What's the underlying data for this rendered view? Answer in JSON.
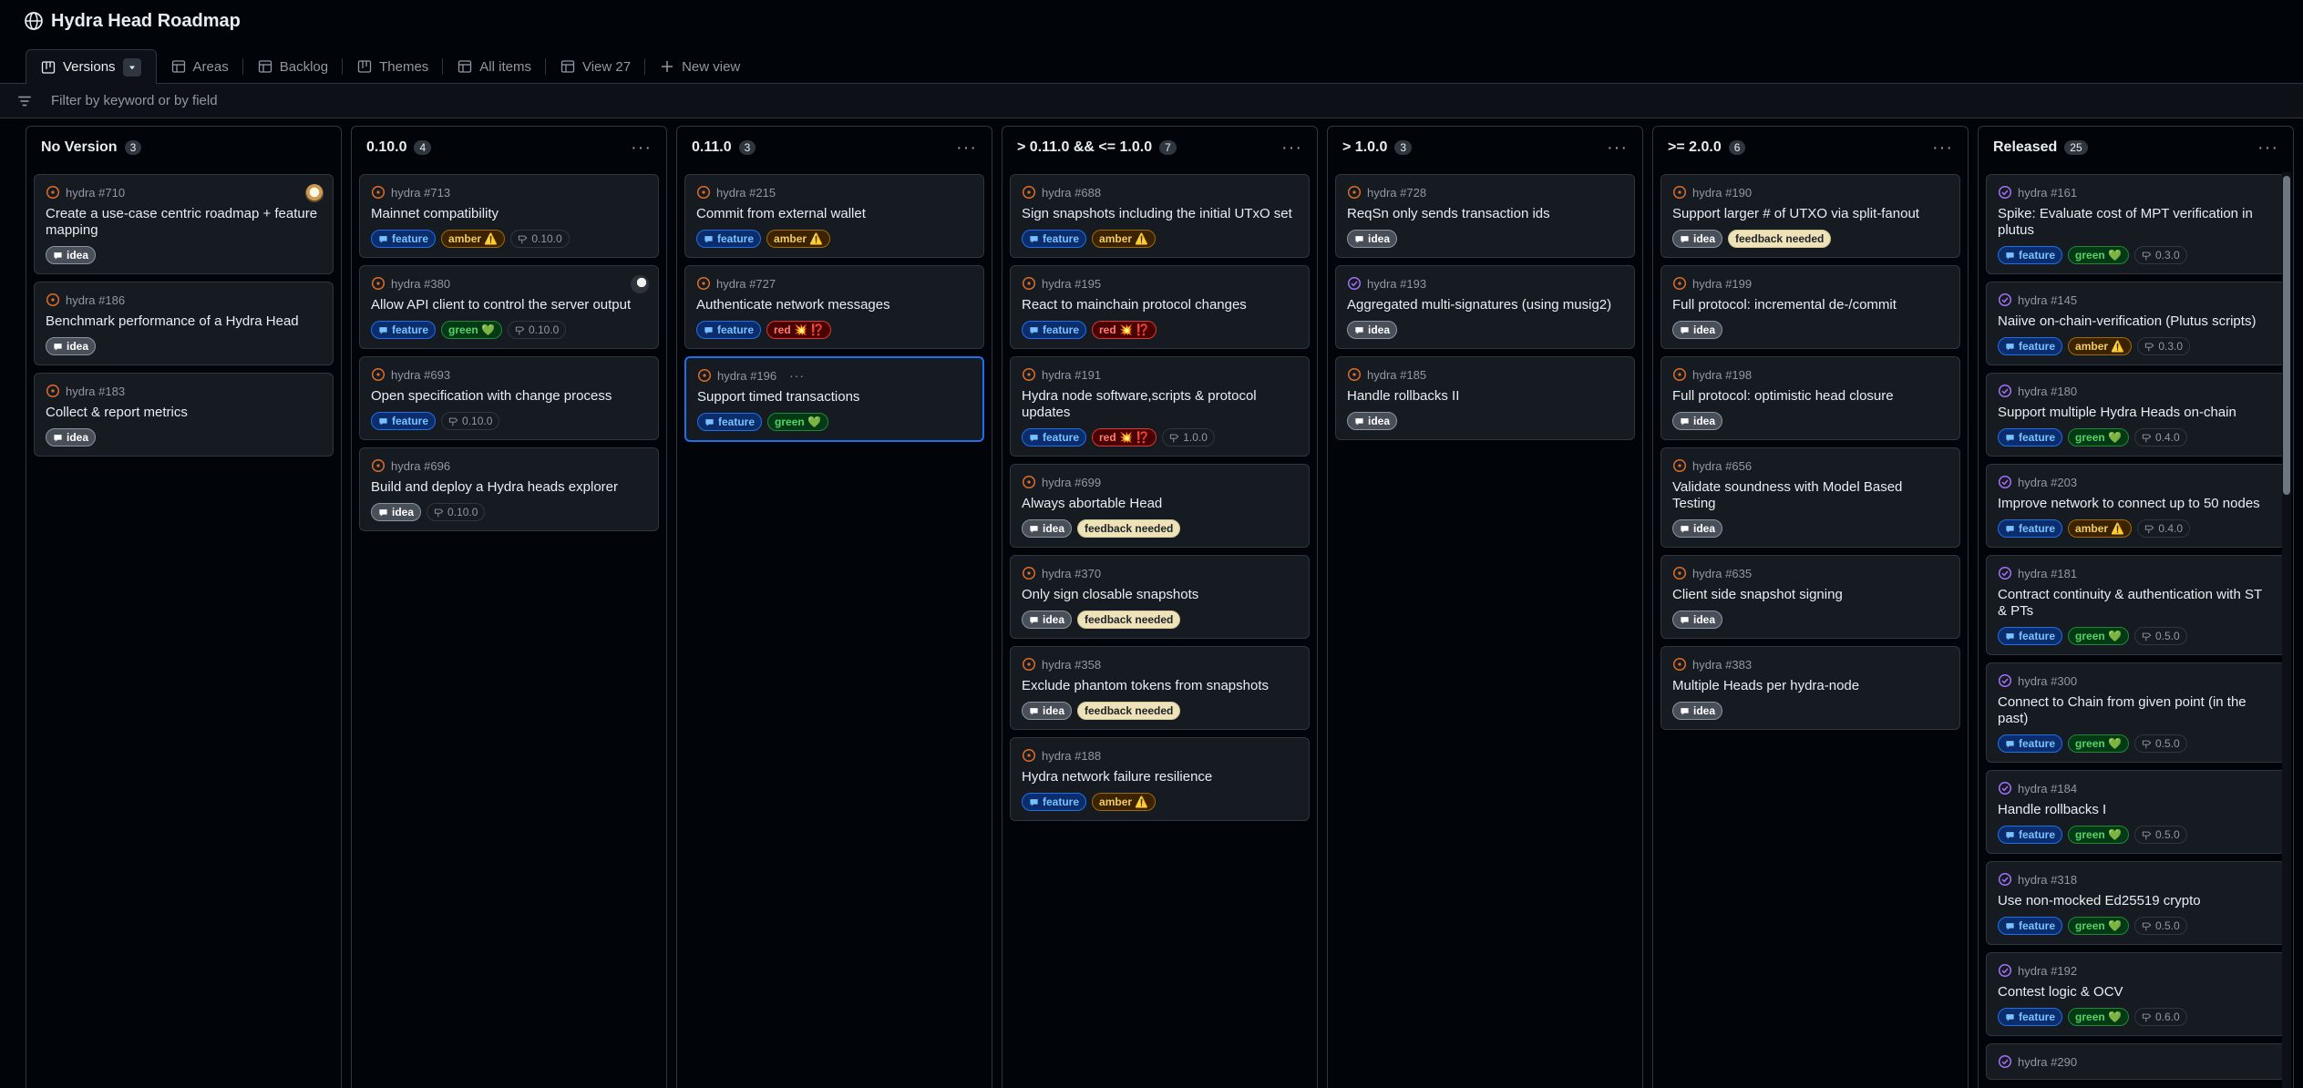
{
  "project": {
    "title": "Hydra Head Roadmap"
  },
  "tabs": [
    {
      "label": "Versions",
      "active": true,
      "icon": "board-icon"
    },
    {
      "label": "Areas",
      "icon": "table-icon"
    },
    {
      "label": "Backlog",
      "icon": "table-icon"
    },
    {
      "label": "Themes",
      "icon": "board-icon"
    },
    {
      "label": "All items",
      "icon": "table-icon"
    },
    {
      "label": "View 27",
      "icon": "table-icon"
    },
    {
      "label": "New view",
      "icon": "plus-icon"
    }
  ],
  "filter": {
    "placeholder": "Filter by keyword or by field"
  },
  "colors": {
    "open_issue": "#db6d28",
    "closed_issue": "#a371f7",
    "selected_border": "#1f6feb"
  },
  "columns": [
    {
      "title": "No Version",
      "count": "3",
      "show_menu": false,
      "cards": [
        {
          "ref": "hydra #710",
          "title": "Create a use-case centric roadmap + feature mapping",
          "status": "open",
          "avatar": "cat",
          "labels": [
            [
              "idea",
              "idea"
            ]
          ]
        },
        {
          "ref": "hydra #186",
          "title": "Benchmark performance of a Hydra Head",
          "status": "open",
          "labels": [
            [
              "idea",
              "idea"
            ]
          ]
        },
        {
          "ref": "hydra #183",
          "title": "Collect & report metrics",
          "status": "open",
          "labels": [
            [
              "idea",
              "idea"
            ]
          ]
        }
      ]
    },
    {
      "title": "0.10.0",
      "count": "4",
      "show_menu": true,
      "cards": [
        {
          "ref": "hydra #713",
          "title": "Mainnet compatibility",
          "status": "open",
          "labels": [
            [
              "feature",
              "feature"
            ],
            [
              "amber",
              "amber ⚠️"
            ]
          ],
          "milestone": "0.10.0"
        },
        {
          "ref": "hydra #380",
          "title": "Allow API client to control the server output",
          "status": "open",
          "avatar": "dark",
          "labels": [
            [
              "feature",
              "feature"
            ],
            [
              "green",
              "green 💚"
            ]
          ],
          "milestone": "0.10.0"
        },
        {
          "ref": "hydra #693",
          "title": "Open specification with change process",
          "status": "open",
          "labels": [
            [
              "feature",
              "feature"
            ]
          ],
          "milestone": "0.10.0"
        },
        {
          "ref": "hydra #696",
          "title": "Build and deploy a Hydra heads explorer",
          "status": "open",
          "labels": [
            [
              "idea",
              "idea"
            ]
          ],
          "milestone": "0.10.0"
        }
      ]
    },
    {
      "title": "0.11.0",
      "count": "3",
      "show_menu": true,
      "cards": [
        {
          "ref": "hydra #215",
          "title": "Commit from external wallet",
          "status": "open",
          "labels": [
            [
              "feature",
              "feature"
            ],
            [
              "amber",
              "amber ⚠️"
            ]
          ]
        },
        {
          "ref": "hydra #727",
          "title": "Authenticate network messages",
          "status": "open",
          "labels": [
            [
              "feature",
              "feature"
            ],
            [
              "red",
              "red 💥 ⁉️"
            ]
          ]
        },
        {
          "ref": "hydra #196",
          "title": "Support timed transactions",
          "status": "open",
          "selected": true,
          "more": "···",
          "labels": [
            [
              "feature",
              "feature"
            ],
            [
              "green",
              "green 💚"
            ]
          ]
        }
      ]
    },
    {
      "title": "> 0.11.0 && <= 1.0.0",
      "count": "7",
      "show_menu": true,
      "cards": [
        {
          "ref": "hydra #688",
          "title": "Sign snapshots including the initial UTxO set",
          "status": "open",
          "labels": [
            [
              "feature",
              "feature"
            ],
            [
              "amber",
              "amber ⚠️"
            ]
          ]
        },
        {
          "ref": "hydra #195",
          "title": "React to mainchain protocol changes",
          "status": "open",
          "labels": [
            [
              "feature",
              "feature"
            ],
            [
              "red",
              "red 💥 ⁉️"
            ]
          ]
        },
        {
          "ref": "hydra #191",
          "title": "Hydra node software,scripts & protocol updates",
          "status": "open",
          "labels": [
            [
              "feature",
              "feature"
            ],
            [
              "red",
              "red 💥 ⁉️"
            ]
          ],
          "milestone": "1.0.0"
        },
        {
          "ref": "hydra #699",
          "title": "Always abortable Head",
          "status": "open",
          "labels": [
            [
              "idea",
              "idea"
            ],
            [
              "feedback",
              "feedback needed"
            ]
          ]
        },
        {
          "ref": "hydra #370",
          "title": "Only sign closable snapshots",
          "status": "open",
          "labels": [
            [
              "idea",
              "idea"
            ],
            [
              "feedback",
              "feedback needed"
            ]
          ]
        },
        {
          "ref": "hydra #358",
          "title": "Exclude phantom tokens from snapshots",
          "status": "open",
          "labels": [
            [
              "idea",
              "idea"
            ],
            [
              "feedback",
              "feedback needed"
            ]
          ]
        },
        {
          "ref": "hydra #188",
          "title": "Hydra network failure resilience",
          "status": "open",
          "labels": [
            [
              "feature",
              "feature"
            ],
            [
              "amber",
              "amber ⚠️"
            ]
          ]
        }
      ]
    },
    {
      "title": "> 1.0.0",
      "count": "3",
      "show_menu": true,
      "cards": [
        {
          "ref": "hydra #728",
          "title": "ReqSn only sends transaction ids",
          "status": "open",
          "labels": [
            [
              "idea",
              "idea"
            ]
          ]
        },
        {
          "ref": "hydra #193",
          "title": "Aggregated multi-signatures (using musig2)",
          "status": "closed",
          "labels": [
            [
              "idea",
              "idea"
            ]
          ]
        },
        {
          "ref": "hydra #185",
          "title": "Handle rollbacks II",
          "status": "open",
          "labels": [
            [
              "idea",
              "idea"
            ]
          ]
        }
      ]
    },
    {
      "title": ">= 2.0.0",
      "count": "6",
      "show_menu": true,
      "cards": [
        {
          "ref": "hydra #190",
          "title": "Support larger # of UTXO via split-fanout",
          "status": "open",
          "labels": [
            [
              "idea",
              "idea"
            ],
            [
              "feedback",
              "feedback needed"
            ]
          ]
        },
        {
          "ref": "hydra #199",
          "title": "Full protocol: incremental de-/commit",
          "status": "open",
          "labels": [
            [
              "idea",
              "idea"
            ]
          ]
        },
        {
          "ref": "hydra #198",
          "title": "Full protocol: optimistic head closure",
          "status": "open",
          "labels": [
            [
              "idea",
              "idea"
            ]
          ]
        },
        {
          "ref": "hydra #656",
          "title": "Validate soundness with Model Based Testing",
          "status": "open",
          "labels": [
            [
              "idea",
              "idea"
            ]
          ]
        },
        {
          "ref": "hydra #635",
          "title": "Client side snapshot signing",
          "status": "open",
          "labels": [
            [
              "idea",
              "idea"
            ]
          ]
        },
        {
          "ref": "hydra #383",
          "title": "Multiple Heads per hydra-node",
          "status": "open",
          "labels": [
            [
              "idea",
              "idea"
            ]
          ]
        }
      ]
    },
    {
      "title": "Released",
      "count": "25",
      "show_menu": true,
      "scroll": true,
      "cards": [
        {
          "ref": "hydra #161",
          "title": "Spike: Evaluate cost of MPT verification in plutus",
          "status": "closed",
          "labels": [
            [
              "feature",
              "feature"
            ],
            [
              "green",
              "green 💚"
            ]
          ],
          "milestone": "0.3.0"
        },
        {
          "ref": "hydra #145",
          "title": "Naiive on-chain-verification (Plutus scripts)",
          "status": "closed",
          "labels": [
            [
              "feature",
              "feature"
            ],
            [
              "amber",
              "amber ⚠️"
            ]
          ],
          "milestone": "0.3.0"
        },
        {
          "ref": "hydra #180",
          "title": "Support multiple Hydra Heads on-chain",
          "status": "closed",
          "labels": [
            [
              "feature",
              "feature"
            ],
            [
              "green",
              "green 💚"
            ]
          ],
          "milestone": "0.4.0"
        },
        {
          "ref": "hydra #203",
          "title": "Improve network to connect up to 50 nodes",
          "status": "closed",
          "labels": [
            [
              "feature",
              "feature"
            ],
            [
              "amber",
              "amber ⚠️"
            ]
          ],
          "milestone": "0.4.0"
        },
        {
          "ref": "hydra #181",
          "title": "Contract continuity & authentication with ST & PTs",
          "status": "closed",
          "labels": [
            [
              "feature",
              "feature"
            ],
            [
              "green",
              "green 💚"
            ]
          ],
          "milestone": "0.5.0"
        },
        {
          "ref": "hydra #300",
          "title": "Connect to Chain from given point (in the past)",
          "status": "closed",
          "labels": [
            [
              "feature",
              "feature"
            ],
            [
              "green",
              "green 💚"
            ]
          ],
          "milestone": "0.5.0"
        },
        {
          "ref": "hydra #184",
          "title": "Handle rollbacks I",
          "status": "closed",
          "labels": [
            [
              "feature",
              "feature"
            ],
            [
              "green",
              "green 💚"
            ]
          ],
          "milestone": "0.5.0"
        },
        {
          "ref": "hydra #318",
          "title": "Use non-mocked Ed25519 crypto",
          "status": "closed",
          "labels": [
            [
              "feature",
              "feature"
            ],
            [
              "green",
              "green 💚"
            ]
          ],
          "milestone": "0.5.0"
        },
        {
          "ref": "hydra #192",
          "title": "Contest logic & OCV",
          "status": "closed",
          "labels": [
            [
              "feature",
              "feature"
            ],
            [
              "green",
              "green 💚"
            ]
          ],
          "milestone": "0.6.0"
        },
        {
          "ref": "hydra #290",
          "title": "",
          "status": "closed",
          "labels": []
        }
      ]
    }
  ]
}
